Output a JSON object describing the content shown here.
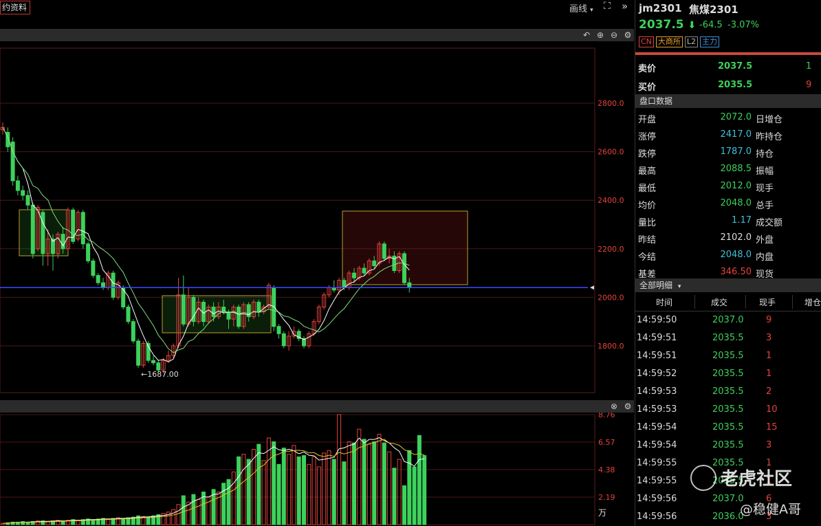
{
  "toolbar": {
    "contract_tag": "约资料",
    "draw_label": "画线",
    "draw_arrow": "▾",
    "fullscreen_icon": "⛶",
    "collapse_icon": "»"
  },
  "main_chart": {
    "price_axis": [
      "2800.0",
      "2600.0",
      "2400.0",
      "2200.0",
      "2000.0",
      "1800.0"
    ],
    "low_marker": "←1687.00",
    "current_line_color": "#3b4bff",
    "candles": [
      {
        "o": 2690,
        "c": 2700,
        "h": 2720,
        "l": 2670
      },
      {
        "o": 2680,
        "c": 2620,
        "h": 2700,
        "l": 2600
      },
      {
        "o": 2640,
        "c": 2480,
        "h": 2660,
        "l": 2460
      },
      {
        "o": 2480,
        "c": 2440,
        "h": 2500,
        "l": 2420
      },
      {
        "o": 2440,
        "c": 2420,
        "h": 2460,
        "l": 2400
      },
      {
        "o": 2420,
        "c": 2380,
        "h": 2440,
        "l": 2360
      },
      {
        "o": 2380,
        "c": 2180,
        "h": 2390,
        "l": 2160
      },
      {
        "o": 2200,
        "c": 2370,
        "h": 2380,
        "l": 2190
      },
      {
        "o": 2350,
        "c": 2180,
        "h": 2360,
        "l": 2130
      },
      {
        "o": 2180,
        "c": 2240,
        "h": 2280,
        "l": 2130
      },
      {
        "o": 2240,
        "c": 2180,
        "h": 2260,
        "l": 2110
      },
      {
        "o": 2180,
        "c": 2260,
        "h": 2270,
        "l": 2160
      },
      {
        "o": 2260,
        "c": 2200,
        "h": 2290,
        "l": 2180
      },
      {
        "o": 2200,
        "c": 2360,
        "h": 2370,
        "l": 2190
      },
      {
        "o": 2360,
        "c": 2230,
        "h": 2370,
        "l": 2220
      },
      {
        "o": 2240,
        "c": 2350,
        "h": 2360,
        "l": 2230
      },
      {
        "o": 2350,
        "c": 2220,
        "h": 2360,
        "l": 2200
      },
      {
        "o": 2220,
        "c": 2150,
        "h": 2230,
        "l": 2140
      },
      {
        "o": 2150,
        "c": 2090,
        "h": 2160,
        "l": 2080
      },
      {
        "o": 2090,
        "c": 2060,
        "h": 2100,
        "l": 2050
      },
      {
        "o": 2060,
        "c": 2040,
        "h": 2080,
        "l": 2030
      },
      {
        "o": 2040,
        "c": 2100,
        "h": 2110,
        "l": 2030
      },
      {
        "o": 2100,
        "c": 2000,
        "h": 2110,
        "l": 1990
      },
      {
        "o": 2000,
        "c": 2060,
        "h": 2070,
        "l": 1990
      },
      {
        "o": 2040,
        "c": 1960,
        "h": 2050,
        "l": 1950
      },
      {
        "o": 1960,
        "c": 1900,
        "h": 1970,
        "l": 1890
      },
      {
        "o": 1900,
        "c": 1820,
        "h": 1910,
        "l": 1810
      },
      {
        "o": 1820,
        "c": 1720,
        "h": 1830,
        "l": 1710
      },
      {
        "o": 1720,
        "c": 1810,
        "h": 1820,
        "l": 1710
      },
      {
        "o": 1810,
        "c": 1740,
        "h": 1820,
        "l": 1730
      },
      {
        "o": 1740,
        "c": 1730,
        "h": 1760,
        "l": 1720
      },
      {
        "o": 1730,
        "c": 1700,
        "h": 1740,
        "l": 1690
      },
      {
        "o": 1700,
        "c": 1740,
        "h": 1750,
        "l": 1687
      },
      {
        "o": 1740,
        "c": 1760,
        "h": 1780,
        "l": 1730
      },
      {
        "o": 1760,
        "c": 1800,
        "h": 1810,
        "l": 1750
      },
      {
        "o": 1800,
        "c": 2010,
        "h": 2080,
        "l": 1790
      },
      {
        "o": 2010,
        "c": 1890,
        "h": 2090,
        "l": 1880
      },
      {
        "o": 1890,
        "c": 2000,
        "h": 2040,
        "l": 1880
      },
      {
        "o": 2000,
        "c": 1900,
        "h": 2010,
        "l": 1880
      },
      {
        "o": 1900,
        "c": 1980,
        "h": 2000,
        "l": 1890
      },
      {
        "o": 1980,
        "c": 1900,
        "h": 1990,
        "l": 1880
      },
      {
        "o": 1900,
        "c": 1960,
        "h": 1970,
        "l": 1890
      },
      {
        "o": 1960,
        "c": 1920,
        "h": 1980,
        "l": 1900
      },
      {
        "o": 1920,
        "c": 1960,
        "h": 1980,
        "l": 1910
      },
      {
        "o": 1960,
        "c": 1940,
        "h": 1990,
        "l": 1930
      },
      {
        "o": 1940,
        "c": 1910,
        "h": 1950,
        "l": 1870
      },
      {
        "o": 1910,
        "c": 1960,
        "h": 1970,
        "l": 1880
      },
      {
        "o": 1960,
        "c": 1880,
        "h": 1970,
        "l": 1870
      },
      {
        "o": 1880,
        "c": 1970,
        "h": 1980,
        "l": 1870
      },
      {
        "o": 1970,
        "c": 1920,
        "h": 1980,
        "l": 1900
      },
      {
        "o": 1920,
        "c": 1980,
        "h": 1990,
        "l": 1910
      },
      {
        "o": 1980,
        "c": 1940,
        "h": 1990,
        "l": 1920
      },
      {
        "o": 1940,
        "c": 1960,
        "h": 1970,
        "l": 1930
      },
      {
        "o": 1960,
        "c": 2050,
        "h": 2060,
        "l": 1950
      },
      {
        "o": 2040,
        "c": 1880,
        "h": 2050,
        "l": 1860
      },
      {
        "o": 1880,
        "c": 1850,
        "h": 1890,
        "l": 1830
      },
      {
        "o": 1850,
        "c": 1800,
        "h": 1860,
        "l": 1790
      },
      {
        "o": 1800,
        "c": 1840,
        "h": 1860,
        "l": 1780
      },
      {
        "o": 1840,
        "c": 1860,
        "h": 1880,
        "l": 1830
      },
      {
        "o": 1860,
        "c": 1830,
        "h": 1870,
        "l": 1820
      },
      {
        "o": 1830,
        "c": 1800,
        "h": 1840,
        "l": 1790
      },
      {
        "o": 1800,
        "c": 1850,
        "h": 1860,
        "l": 1790
      },
      {
        "o": 1850,
        "c": 1900,
        "h": 1910,
        "l": 1840
      },
      {
        "o": 1900,
        "c": 1960,
        "h": 1970,
        "l": 1890
      },
      {
        "o": 1960,
        "c": 2010,
        "h": 2020,
        "l": 1950
      },
      {
        "o": 2010,
        "c": 2040,
        "h": 2050,
        "l": 2000
      },
      {
        "o": 2040,
        "c": 2030,
        "h": 2070,
        "l": 2020
      },
      {
        "o": 2030,
        "c": 2070,
        "h": 2080,
        "l": 2010
      },
      {
        "o": 2070,
        "c": 2040,
        "h": 2080,
        "l": 2030
      },
      {
        "o": 2040,
        "c": 2100,
        "h": 2110,
        "l": 2030
      },
      {
        "o": 2100,
        "c": 2080,
        "h": 2120,
        "l": 2060
      },
      {
        "o": 2080,
        "c": 2120,
        "h": 2130,
        "l": 2070
      },
      {
        "o": 2120,
        "c": 2100,
        "h": 2140,
        "l": 2090
      },
      {
        "o": 2100,
        "c": 2150,
        "h": 2160,
        "l": 2090
      },
      {
        "o": 2150,
        "c": 2130,
        "h": 2170,
        "l": 2120
      },
      {
        "o": 2140,
        "c": 2220,
        "h": 2230,
        "l": 2130
      },
      {
        "o": 2220,
        "c": 2160,
        "h": 2230,
        "l": 2150
      },
      {
        "o": 2160,
        "c": 2170,
        "h": 2200,
        "l": 2140
      },
      {
        "o": 2170,
        "c": 2110,
        "h": 2190,
        "l": 2100
      },
      {
        "o": 2110,
        "c": 2180,
        "h": 2190,
        "l": 2100
      },
      {
        "o": 2180,
        "c": 2060,
        "h": 2190,
        "l": 2050
      },
      {
        "o": 2060,
        "c": 2040,
        "h": 2080,
        "l": 2020
      }
    ]
  },
  "volume_chart": {
    "axis": [
      "8.76",
      "6.57",
      "4.38",
      "2.19"
    ],
    "unit": "万",
    "values": [
      0.1,
      0.15,
      0.2,
      0.2,
      0.25,
      0.2,
      0.25,
      0.3,
      0.3,
      0.25,
      0.3,
      0.35,
      0.3,
      0.35,
      0.4,
      0.35,
      0.4,
      0.45,
      0.4,
      0.45,
      0.5,
      0.45,
      0.5,
      0.55,
      0.5,
      0.55,
      0.6,
      0.7,
      0.65,
      0.6,
      0.7,
      0.8,
      0.9,
      1.0,
      1.2,
      1.6,
      2.3,
      1.8,
      2.4,
      2.0,
      2.6,
      2.2,
      2.8,
      2.6,
      3.3,
      3.6,
      4.2,
      5.4,
      5.6,
      5.2,
      6.0,
      6.4,
      5.1,
      6.9,
      6.6,
      4.8,
      6.1,
      5.6,
      6.3,
      5.4,
      5.5,
      4.8,
      5.4,
      4.6,
      5.7,
      5.9,
      5.2,
      8.76,
      5.0,
      6.6,
      6.5,
      7.6,
      6.8,
      6.4,
      6.6,
      7.2,
      6.5,
      5.8,
      4.5,
      5.2,
      3.1,
      5.9,
      4.6,
      7.1,
      5.5
    ],
    "ma_color_1": "#ffffff",
    "ma_color_2": "#e6c229"
  },
  "quote": {
    "symbol": "jm2301",
    "name": "焦煤2301",
    "price": "2037.5",
    "arrow": "⬇",
    "change": "-64.5",
    "change_pct": "-3.07%",
    "tags": [
      "CN",
      "大商所",
      "L2",
      "主力"
    ],
    "ask_label": "卖价",
    "ask_price": "2037.5",
    "ask_qty": "1",
    "bid_label": "买价",
    "bid_price": "2035.5",
    "bid_qty": "9"
  },
  "panel": {
    "title": "盘口数据",
    "rows": [
      {
        "k": "开盘",
        "v": "2072.0",
        "k2": "日增仓"
      },
      {
        "k": "涨停",
        "v": "2417.0",
        "k2": "昨持仓"
      },
      {
        "k": "跌停",
        "v": "1787.0",
        "k2": "持仓"
      },
      {
        "k": "最高",
        "v": "2088.5",
        "k2": "振幅"
      },
      {
        "k": "最低",
        "v": "2012.0",
        "k2": "现手"
      },
      {
        "k": "均价",
        "v": "2048.0",
        "k2": "总手"
      },
      {
        "k": "量比",
        "v": "1.17",
        "k2": "成交额"
      },
      {
        "k": "昨结",
        "v": "2102.0",
        "k2": "外盘"
      },
      {
        "k": "今结",
        "v": "2048.0",
        "k2": "内盘"
      },
      {
        "k": "基差",
        "v": "346.50",
        "k2": "现货"
      }
    ]
  },
  "trades": {
    "title": "全部明细",
    "dropdown_icon": "▾",
    "headers": [
      "时间",
      "成交",
      "现手",
      "增仓"
    ],
    "rows": [
      {
        "t": "14:59:50",
        "p": "2037.0",
        "q": "9"
      },
      {
        "t": "14:59:51",
        "p": "2035.5",
        "q": "3"
      },
      {
        "t": "14:59:51",
        "p": "2035.5",
        "q": "1"
      },
      {
        "t": "14:59:52",
        "p": "2035.5",
        "q": "1"
      },
      {
        "t": "14:59:53",
        "p": "2035.5",
        "q": "2"
      },
      {
        "t": "14:59:53",
        "p": "2035.5",
        "q": "10"
      },
      {
        "t": "14:59:54",
        "p": "2035.5",
        "q": "15"
      },
      {
        "t": "14:59:54",
        "p": "2035.5",
        "q": "3"
      },
      {
        "t": "14:59:55",
        "p": "2035.5",
        "q": "1"
      },
      {
        "t": "14:59:55",
        "p": "2035.5",
        "q": "1"
      },
      {
        "t": "14:59:56",
        "p": "2037.0",
        "q": "6"
      },
      {
        "t": "14:59:56",
        "p": "2036.0",
        "q": "3"
      }
    ]
  },
  "watermark": {
    "brand": "老虎社区",
    "author": "@稳健A哥"
  }
}
